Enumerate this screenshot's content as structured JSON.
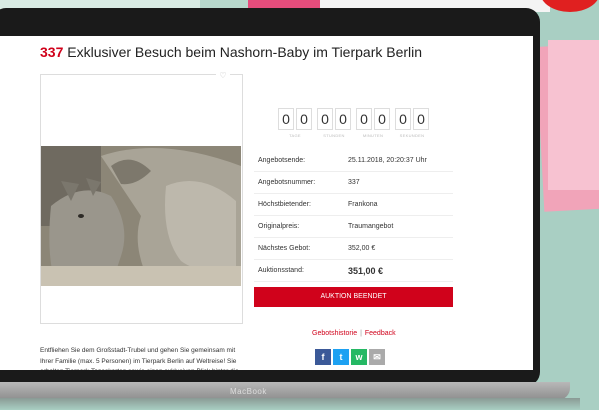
{
  "page": {
    "title_number": "337",
    "title_text": " Exklusiver Besuch beim Nashorn-Baby im Tierpark Berlin"
  },
  "countdown": {
    "groups": [
      {
        "digits": [
          "0",
          "0"
        ],
        "unit": "TAGE"
      },
      {
        "digits": [
          "0",
          "0"
        ],
        "unit": "STUNDEN"
      },
      {
        "digits": [
          "0",
          "0"
        ],
        "unit": "MINUTEN"
      },
      {
        "digits": [
          "0",
          "0"
        ],
        "unit": "SEKUNDEN"
      }
    ]
  },
  "info": [
    {
      "label": "Angebotsende:",
      "value": "25.11.2018, 20:20:37 Uhr"
    },
    {
      "label": "Angebotsnummer:",
      "value": "337"
    },
    {
      "label": "Höchstbietender:",
      "value": "Frankona"
    },
    {
      "label": "Originalpreis:",
      "value": "Traumangebot"
    },
    {
      "label": "Nächstes Gebot:",
      "value": "352,00 €"
    },
    {
      "label": "Auktionsstand:",
      "value": "351,00 €"
    }
  ],
  "end_button": "AUKTION BEENDET",
  "links": {
    "history": "Gebotshistorie",
    "separator": "|",
    "feedback": "Feedback"
  },
  "social": [
    {
      "icon": "facebook-icon",
      "glyph": "f",
      "color": "#3b5998"
    },
    {
      "icon": "twitter-icon",
      "glyph": "t",
      "color": "#1da1f2"
    },
    {
      "icon": "whatsapp-icon",
      "glyph": "w",
      "color": "#25b864"
    },
    {
      "icon": "email-icon",
      "glyph": "✉",
      "color": "#aaaaaa"
    }
  ],
  "description": "Entfliehen Sie dem Großstadt-Trubel und gehen Sie gemeinsam mit Ihrer Familie (max. 5 Personen) im Tierpark Berlin auf Weltreise! Sie erhalten Tierpark-Tageskarten sowie einen exklusiven Blick hinter die Kulissen bei den Panzernashörnern.",
  "device": {
    "brand": "MacBook"
  },
  "colors": {
    "accent": "#d0021b",
    "background": "#a9cfc3"
  }
}
